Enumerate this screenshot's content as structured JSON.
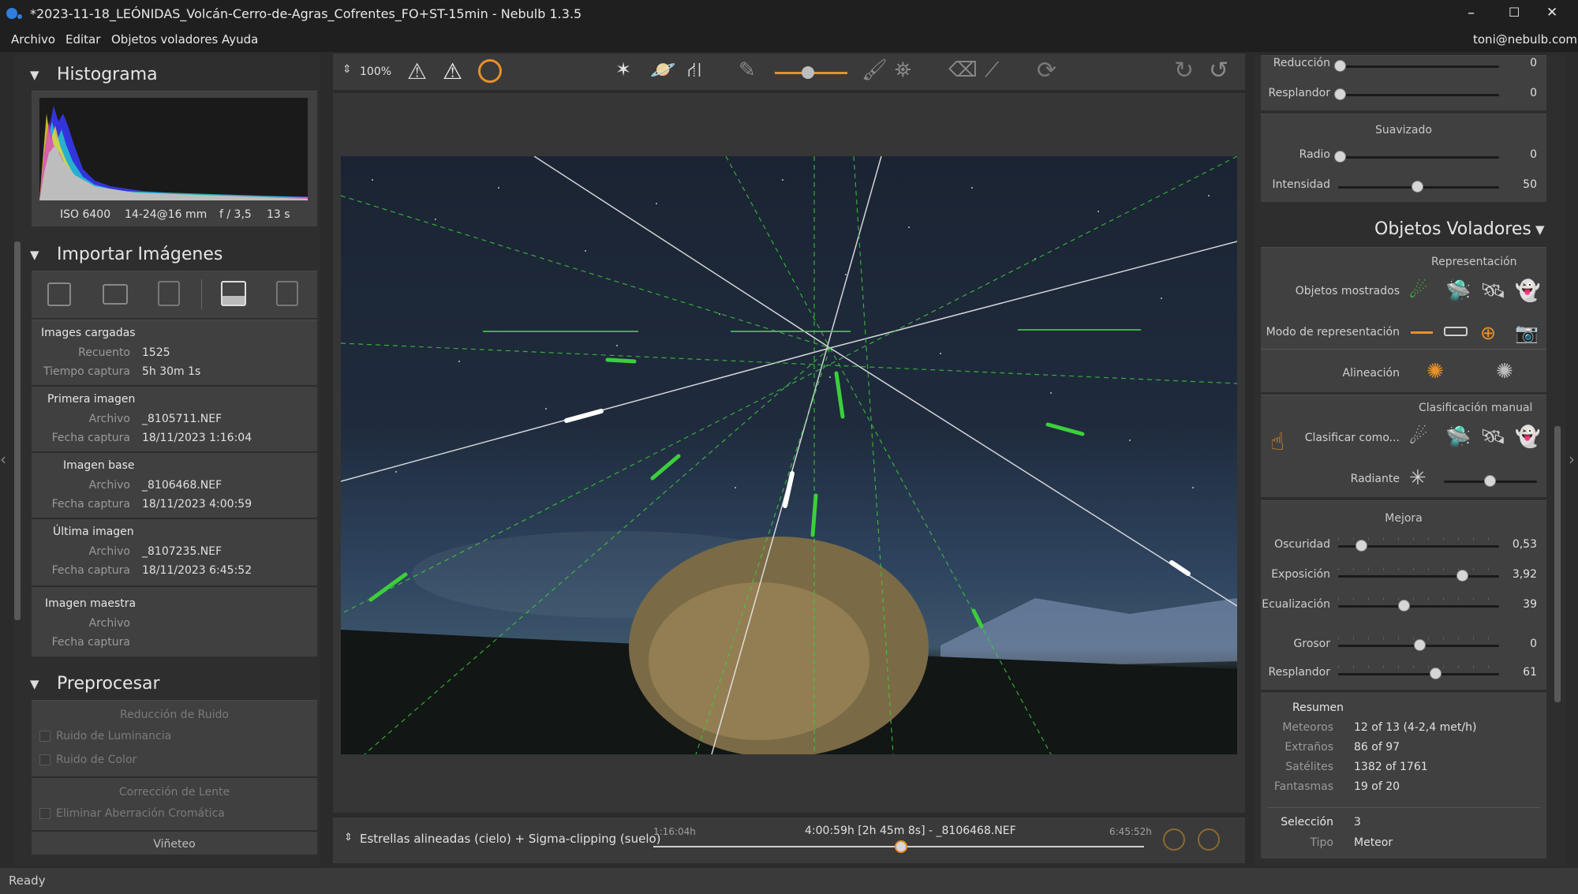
{
  "window": {
    "title": "*2023-11-18_LEÓNIDAS_Volcán-Cerro-de-Agras_Cofrentes_FO+ST-15min - Nebulb 1.3.5",
    "min": "–",
    "max": "☐",
    "close": "✕"
  },
  "menu": {
    "items": [
      "Archivo",
      "Editar",
      "Objetos voladores",
      "Ayuda"
    ],
    "user": "toni@nebulb.com"
  },
  "toolbar": {
    "zoom": "100%",
    "zoom_arrow": "⇕"
  },
  "left": {
    "histogram": {
      "title": "Histograma",
      "iso": "ISO 6400",
      "lens": "14-24@16 mm",
      "aperture": "f / 3,5",
      "exposure": "13 s"
    },
    "import": {
      "title": "Importar Imágenes",
      "loaded": {
        "header": "Images cargadas",
        "count_label": "Recuento",
        "count": "1525",
        "time_label": "Tiempo captura",
        "time": "5h 30m 1s"
      },
      "first": {
        "header": "Primera imagen",
        "file_label": "Archivo",
        "file": "_8105711.NEF",
        "date_label": "Fecha captura",
        "date": "18/11/2023 1:16:04"
      },
      "base": {
        "header": "Imagen base",
        "file_label": "Archivo",
        "file": "_8106468.NEF",
        "date_label": "Fecha captura",
        "date": "18/11/2023 4:00:59"
      },
      "last": {
        "header": "Última imagen",
        "file_label": "Archivo",
        "file": "_8107235.NEF",
        "date_label": "Fecha captura",
        "date": "18/11/2023 6:45:52"
      },
      "master": {
        "header": "Imagen maestra",
        "file_label": "Archivo",
        "date_label": "Fecha captura"
      }
    },
    "preprocess": {
      "title": "Preprocesar",
      "noise": "Reducción de Ruido",
      "lum": "Ruido de Luminancia",
      "color": "Ruido de Color",
      "lens": "Corrección de Lente",
      "aberr": "Eliminar Aberración Cromática",
      "vignette": "Viñeteo"
    }
  },
  "bottom": {
    "mode_arrow": "⇕",
    "mode": "Estrellas alineadas (cielo) + Sigma-clipping (suelo)",
    "start": "1:16:04h",
    "center": "4:00:59h [2h 45m 8s] - _8106468.NEF",
    "end": "6:45:52h",
    "timeline_position": 0.5
  },
  "right": {
    "reduccion_label": "Reducción",
    "reduccion": "0",
    "resplandor_top_label": "Resplandor",
    "resplandor_top": "0",
    "suavizado": "Suavizado",
    "radio_label": "Radio",
    "radio": "0",
    "intensidad_label": "Intensidad",
    "intensidad": "50",
    "flying": {
      "title": "Objetos Voladores",
      "arrow": "▼",
      "representacion": "Representación",
      "mostrados": "Objetos mostrados",
      "modo": "Modo de representación",
      "alineacion": "Alineación",
      "clasificacion": "Clasificación manual",
      "clasificar": "Clasificar como...",
      "radiante": "Radiante",
      "mejora": "Mejora",
      "oscuridad_label": "Oscuridad",
      "oscuridad": "0,53",
      "exposicion_label": "Exposición",
      "exposicion": "3,92",
      "ecualizacion_label": "Ecualización",
      "ecualizacion": "39",
      "grosor_label": "Grosor",
      "grosor": "0",
      "resplandor_label": "Resplandor",
      "resplandor": "61"
    },
    "resumen": {
      "title": "Resumen",
      "meteoros_label": "Meteoros",
      "meteoros": "12 of 13 (4-2,4 met/h)",
      "extranos_label": "Extraños",
      "extranos": "86 of 97",
      "satelites_label": "Satélites",
      "satelites": "1382 of 1761",
      "fantasmas_label": "Fantasmas",
      "fantasmas": "19 of 20",
      "seleccion_label": "Selección",
      "seleccion": "3",
      "tipo_label": "Tipo",
      "tipo": "Meteor"
    }
  },
  "status": "Ready",
  "colors": {
    "accent": "#e8902a",
    "meteor": "#3ccf3c"
  }
}
